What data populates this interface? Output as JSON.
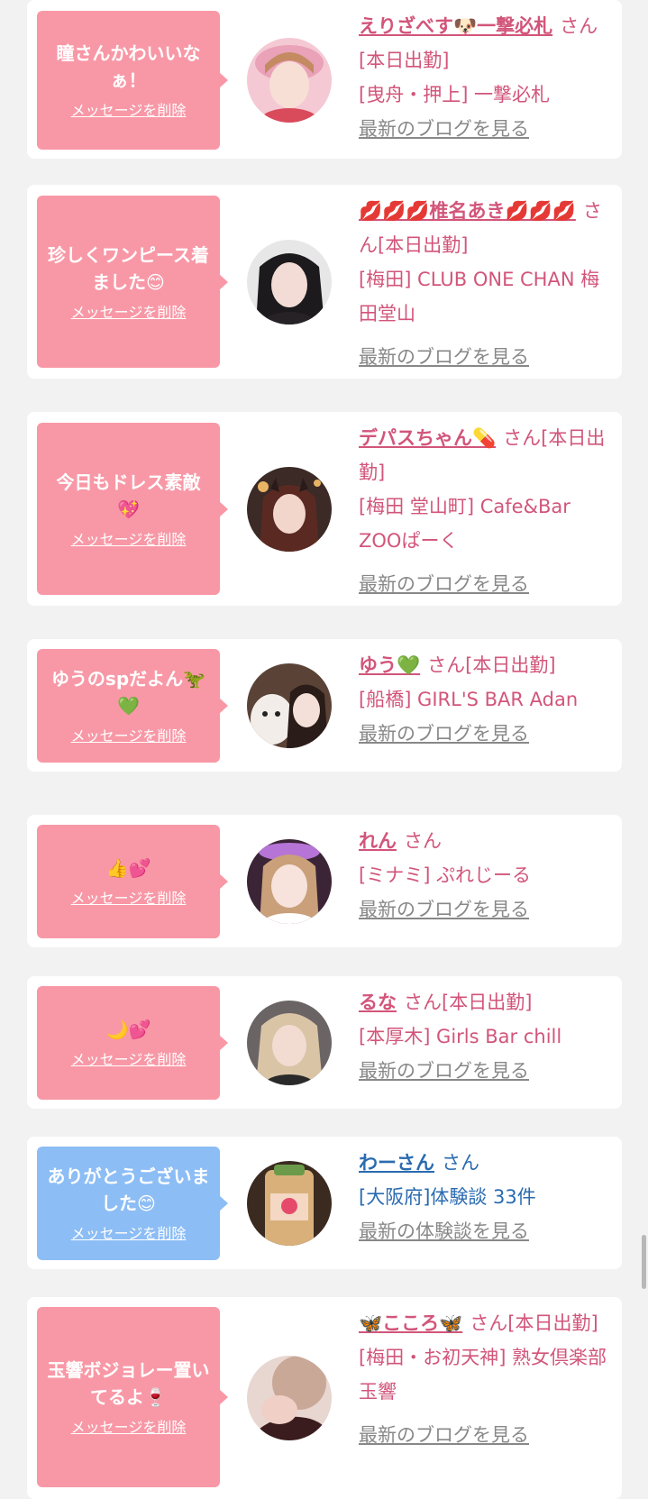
{
  "delete_label": "メッセージを削除",
  "cards": [
    {
      "message": "瞳さんかわいいなぁ！",
      "name": "えりざべす🐶一撃必札",
      "suffix": "さん[本日出勤]",
      "shop": "[曳舟・押上] 一撃必札",
      "link": "最新のブログを見る",
      "bubble_color": "#f898a6"
    },
    {
      "message": "珍しくワンピース着ました😊",
      "name": "💋💋💋椎名あき💋💋💋",
      "suffix": "さん[本日出勤]",
      "shop": "[梅田] CLUB ONE CHAN 梅田堂山",
      "link": "最新のブログを見る",
      "bubble_color": "#f898a6"
    },
    {
      "message": "今日もドレス素敵💖",
      "name": "デパスちゃん💊",
      "suffix": "さん[本日出勤]",
      "shop": "[梅田 堂山町] Cafe&Bar ZOOぱーく",
      "link": "最新のブログを見る",
      "bubble_color": "#f898a6"
    },
    {
      "message": "ゆうのspだよん🦖💚",
      "name": "ゆう💚",
      "suffix": "さん[本日出勤]",
      "shop": "[船橋] GIRL'S BAR Adan",
      "link": "最新のブログを見る",
      "bubble_color": "#f898a6"
    },
    {
      "message": "👍💕",
      "name": "れん",
      "suffix": "さん",
      "shop": "[ミナミ] ぷれじーる",
      "link": "最新のブログを見る",
      "bubble_color": "#f898a6"
    },
    {
      "message": "🌙💕",
      "name": "るな",
      "suffix": "さん[本日出勤]",
      "shop": "[本厚木] Girls Bar chill",
      "link": "最新のブログを見る",
      "bubble_color": "#f898a6"
    },
    {
      "message": "ありがとうございました😊",
      "name": "わーさん",
      "suffix": "さん",
      "shop": "[大阪府]体験談 33件",
      "link": "最新の体験談を見る",
      "bubble_color": "#8cbdf5"
    },
    {
      "message": "玉響ボジョレー置いてるよ🍷",
      "name": "🦋こころ🦋",
      "suffix": "さん[本日出勤]",
      "shop": "[梅田・お初天神] 熟女倶楽部 玉響",
      "link": "最新のブログを見る",
      "bubble_color": "#f898a6"
    }
  ]
}
